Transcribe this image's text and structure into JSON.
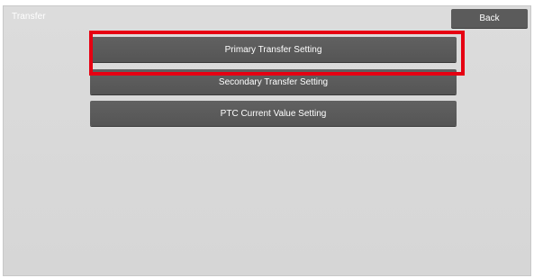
{
  "header": {
    "title": "Transfer",
    "back_label": "Back"
  },
  "menu": {
    "items": [
      {
        "label": "Primary Transfer Setting",
        "highlighted": true
      },
      {
        "label": "Secondary Transfer Setting",
        "highlighted": false
      },
      {
        "label": "PTC Current Value Setting",
        "highlighted": false
      }
    ]
  },
  "colors": {
    "background": "#d9d9d9",
    "button": "#595959",
    "button_text": "#ffffff",
    "highlight": "#e60012"
  }
}
